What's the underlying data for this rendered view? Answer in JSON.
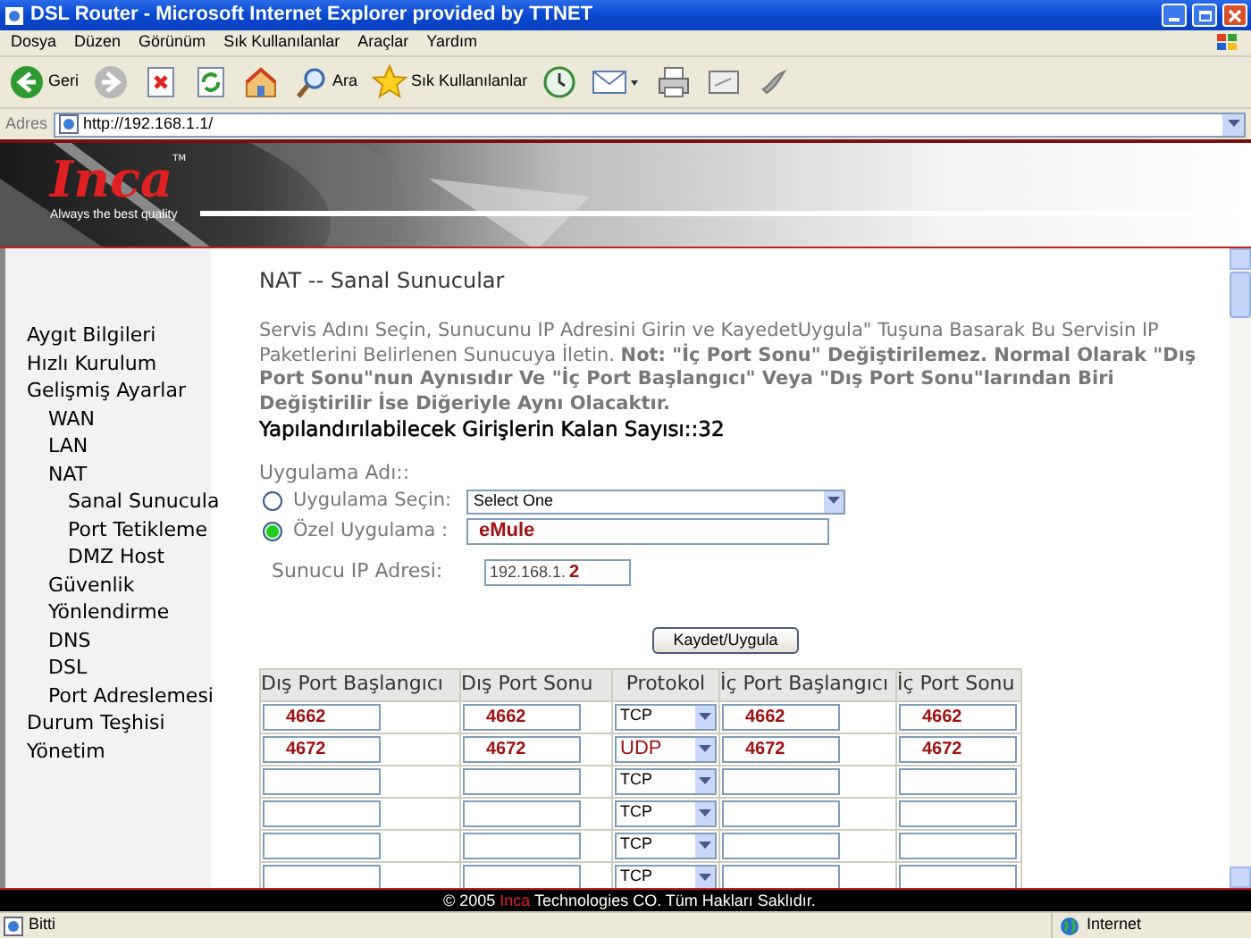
{
  "window": {
    "title": "DSL Router - Microsoft Internet Explorer provided by TTNET"
  },
  "menu": [
    "Dosya",
    "Düzen",
    "Görünüm",
    "Sık Kullanılanlar",
    "Araçlar",
    "Yardım"
  ],
  "toolbar": [
    {
      "kind": "back",
      "label": "Geri"
    },
    {
      "kind": "forward"
    },
    {
      "kind": "stop"
    },
    {
      "kind": "refresh"
    },
    {
      "kind": "home"
    },
    {
      "kind": "search",
      "label": "Ara"
    },
    {
      "kind": "favorites",
      "label": "Sık Kullanılanlar"
    },
    {
      "kind": "history"
    },
    {
      "kind": "mail"
    },
    {
      "kind": "print"
    },
    {
      "kind": "edit"
    },
    {
      "kind": "messenger"
    }
  ],
  "address_bar": {
    "label": "Adres",
    "value": "http://192.168.1.1/"
  },
  "logo": {
    "brand": "Inca",
    "tm": "TM",
    "tagline": "Always the best quality"
  },
  "sidebar": {
    "items": [
      {
        "label": "Aygıt Bilgileri"
      },
      {
        "label": "Hızlı Kurulum"
      },
      {
        "label": "Gelişmiş Ayarlar",
        "children": [
          {
            "label": "WAN"
          },
          {
            "label": "LAN"
          },
          {
            "label": "NAT",
            "children": [
              {
                "label": "Sanal Sunucula"
              },
              {
                "label": "Port Tetikleme"
              },
              {
                "label": "DMZ Host"
              }
            ]
          },
          {
            "label": "Güvenlik"
          },
          {
            "label": "Yönlendirme"
          },
          {
            "label": "DNS"
          },
          {
            "label": "DSL"
          },
          {
            "label": "Port Adreslemesi"
          }
        ]
      },
      {
        "label": "Durum Teşhisi"
      },
      {
        "label": "Yönetim"
      }
    ]
  },
  "page": {
    "heading": "NAT -- Sanal Sunucular",
    "description": "Servis Adını Seçin, Sunucunu IP Adresini Girin ve  KayedetUygula\" Tuşuna Basarak Bu Servisin IP Paketlerini Belirlenen Sunucuya İletin. **Not: \"İç Port Sonu\" Değiştirilemez. Normal Olarak \"Dış Port Sonu\"nun Aynısıdır Ve  \"İç Port Başlangıcı\" Veya \"Dış Port Sonu\"larından Biri Değiştirilir İse Diğeriyle Aynı Olacaktır.**",
    "remaining": "Yapılandırılabilecek Girişlerin Kalan Sayısı::32",
    "app_name_label": "Uygulama Adı::",
    "options": [
      {
        "kind": "select",
        "label": "Uygulama Seçin:",
        "selected": false,
        "value": "Select One"
      },
      {
        "kind": "text",
        "label": "Özel Uygulama :",
        "selected": true,
        "value": "eMule"
      }
    ],
    "server_ip": {
      "label": "Sunucu IP Adresi:",
      "prefix": "192.168.1.",
      "value": "2"
    },
    "save_button": "Kaydet/Uygula",
    "table": {
      "columns": [
        "Dış Port Başlangıcı",
        "Dış Port Sonu",
        "Protokol",
        "İç Port Başlangıcı",
        "İç Port Sonu"
      ],
      "rows": [
        {
          "ext_start": "4662",
          "ext_end": "4662",
          "protocol": "TCP",
          "protocol_changed": false,
          "int_start": "4662",
          "int_end": "4662"
        },
        {
          "ext_start": "4672",
          "ext_end": "4672",
          "protocol": "UDP",
          "protocol_changed": true,
          "int_start": "4672",
          "int_end": "4672"
        },
        {
          "protocol": "TCP",
          "protocol_changed": false
        },
        {
          "protocol": "TCP",
          "protocol_changed": false
        },
        {
          "protocol": "TCP",
          "protocol_changed": false
        },
        {
          "protocol": "TCP",
          "protocol_changed": false
        }
      ]
    }
  },
  "footer": {
    "before": "© 2005",
    "brand": "Inca",
    "after": "Technologies CO. Tüm Hakları Saklıdır."
  },
  "status_bar": {
    "text": "Bitti",
    "zone": "Internet"
  }
}
